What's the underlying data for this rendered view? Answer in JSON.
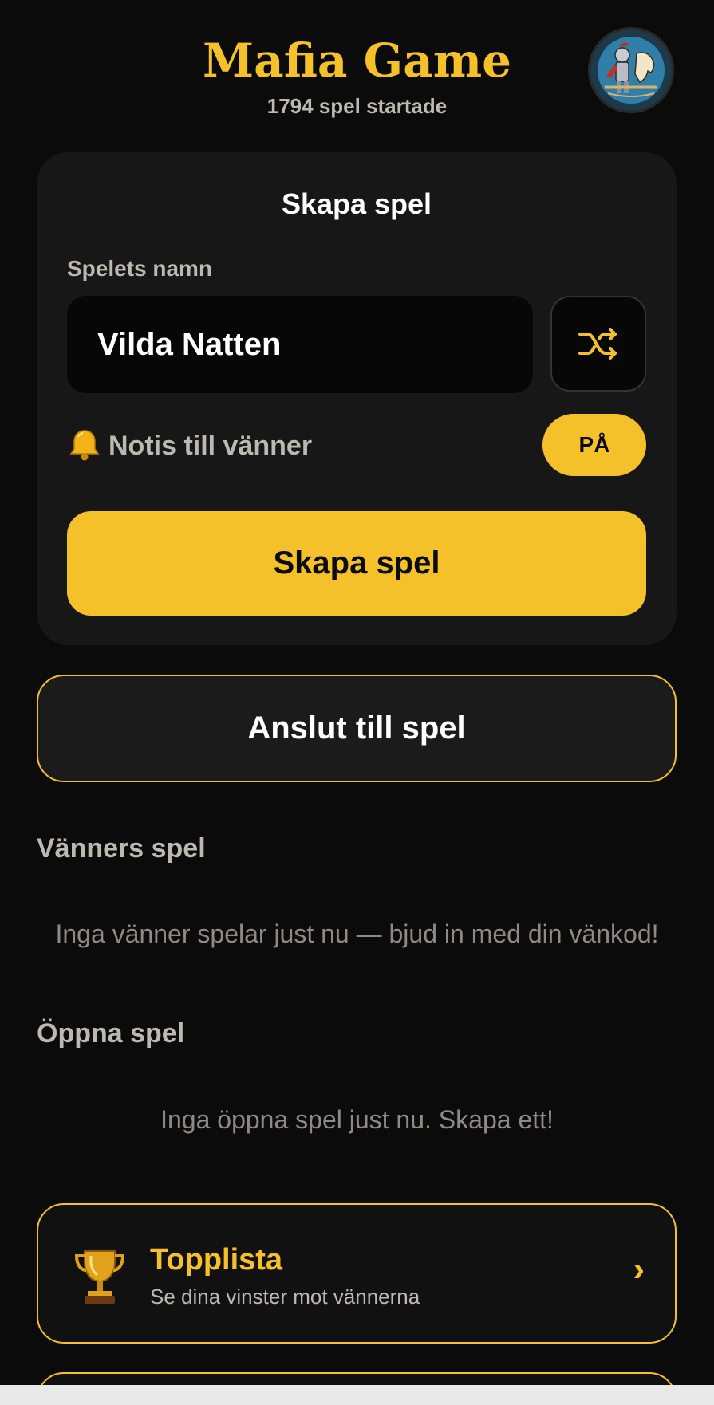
{
  "header": {
    "title": "Mafia Game",
    "games_started": "1794 spel startade",
    "avatar_icon": "knight-avatar-icon"
  },
  "create_card": {
    "title": "Skapa spel",
    "name_label": "Spelets namn",
    "name_value": "Vilda Natten",
    "shuffle_icon": "shuffle-icon",
    "notify_icon": "bell-icon",
    "notify_label": "Notis till vänner",
    "notify_toggle": "PÅ",
    "create_button": "Skapa spel"
  },
  "join_button": "Anslut till spel",
  "friends_games": {
    "heading": "Vänners spel",
    "empty": "Inga vänner spelar just nu — bjud in med din vänkod!"
  },
  "open_games": {
    "heading": "Öppna spel",
    "empty": "Inga öppna spel just nu. Skapa ett!"
  },
  "leaderboard": {
    "icon": "trophy-icon",
    "title": "Topplista",
    "subtitle": "Se dina vinster mot vännerna",
    "chevron": "›"
  },
  "colors": {
    "background": "#0b0b0b",
    "accent": "#f5c12b",
    "card": "#171717",
    "muted_text": "#bcb9b0"
  }
}
